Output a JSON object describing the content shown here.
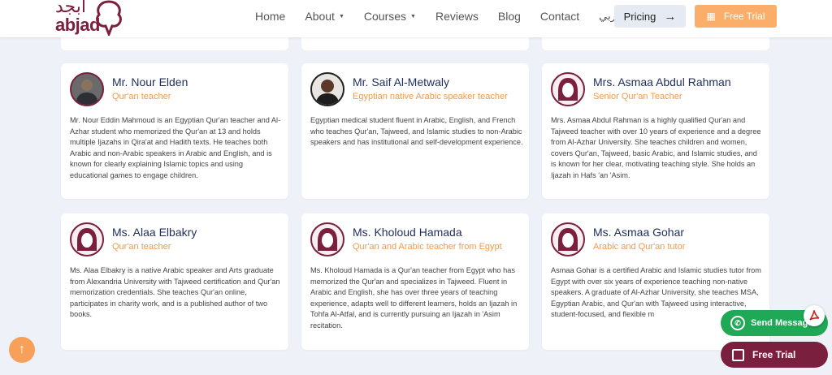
{
  "header": {
    "logo_ar": "أبجد",
    "logo_en": "abjad",
    "nav": [
      {
        "label": "Home",
        "dropdown": false
      },
      {
        "label": "About",
        "dropdown": true
      },
      {
        "label": "Courses",
        "dropdown": true
      },
      {
        "label": "Reviews",
        "dropdown": false
      },
      {
        "label": "Blog",
        "dropdown": false
      },
      {
        "label": "Contact",
        "dropdown": false
      }
    ],
    "lang": "عربي",
    "pricing_label": "Pricing",
    "trial_label": "Free Trial"
  },
  "teachers": [
    {
      "name": "Mr. Nour Elden",
      "role": "Qur'an teacher",
      "bio": "Mr. Nour Eddin Mahmoud is an Egyptian Qur'an teacher and Al-Azhar student who memorized the Qur'an at 13 and holds multiple Ijazahs in Qira'at and Hadith texts. He teaches both Arabic and non-Arabic speakers in Arabic and English, and is known for clearly explaining Islamic topics and using educational games to engage children.",
      "avatar": "photo"
    },
    {
      "name": "Mr. Saif Al-Metwaly",
      "role": "Egyptian native Arabic speaker teacher",
      "bio": "Egyptian medical student fluent in Arabic, English, and French who teaches Qur'an, Tajweed, and Islamic studies to non-Arabic speakers and has institutional and self-development experience.",
      "avatar": "photo"
    },
    {
      "name": "Mrs. Asmaa Abdul Rahman",
      "role": "Senior Qur'an Teacher",
      "bio": "Mrs. Asmaa Abdul Rahman is a highly qualified Qur'an and Tajweed teacher with over 10 years of experience and a degree from Al-Azhar University. She teaches children and women, covers Qur'an, Tajweed, basic Arabic, and Islamic studies, and is known for her clear, motivating teaching style. She holds an Ijazah in Hafs 'an 'Asim.",
      "avatar": "hijab"
    },
    {
      "name": "Ms. Alaa Elbakry",
      "role": "Qur'an teacher",
      "bio": "Ms. Alaa Elbakry is a native Arabic speaker and Arts graduate from Alexandria University with Tajweed certification and Qur'an memorization credentials. She teaches Qur'an online, participates in charity work, and is a published author of two books.",
      "avatar": "hijab"
    },
    {
      "name": "Ms. Kholoud Hamada",
      "role": "Qur'an and Arabic teacher from Egypt",
      "bio": "Ms. Kholoud Hamada is a Qur'an teacher from Egypt who has memorized the Qur'an and specializes in Tajweed. Fluent in Arabic and English, she has over three years of teaching experience, adapts well to different learners, holds an Ijazah in Tohfa Al-Atfal, and is currently pursuing an Ijazah in 'Asim recitation.",
      "avatar": "hijab"
    },
    {
      "name": "Ms. Asmaa Gohar",
      "role": "Arabic and Qur'an tutor",
      "bio": "Asmaa Gohar is a certified Arabic and Islamic studies tutor from Egypt with over six years of experience teaching non-native speakers. A graduate of Al-Azhar University, she teaches MSA, Egyptian Arabic, and Qur'an with Tajweed using interactive, student-focused, and flexible m",
      "avatar": "hijab"
    }
  ],
  "floating": {
    "whatsapp_label": "Send Message",
    "free_trial_label": "Free Trial"
  },
  "colors": {
    "brand": "#7a1f3d",
    "accent": "#f39a4a",
    "whatsapp": "#1fa855",
    "background": "#eef1f8"
  }
}
